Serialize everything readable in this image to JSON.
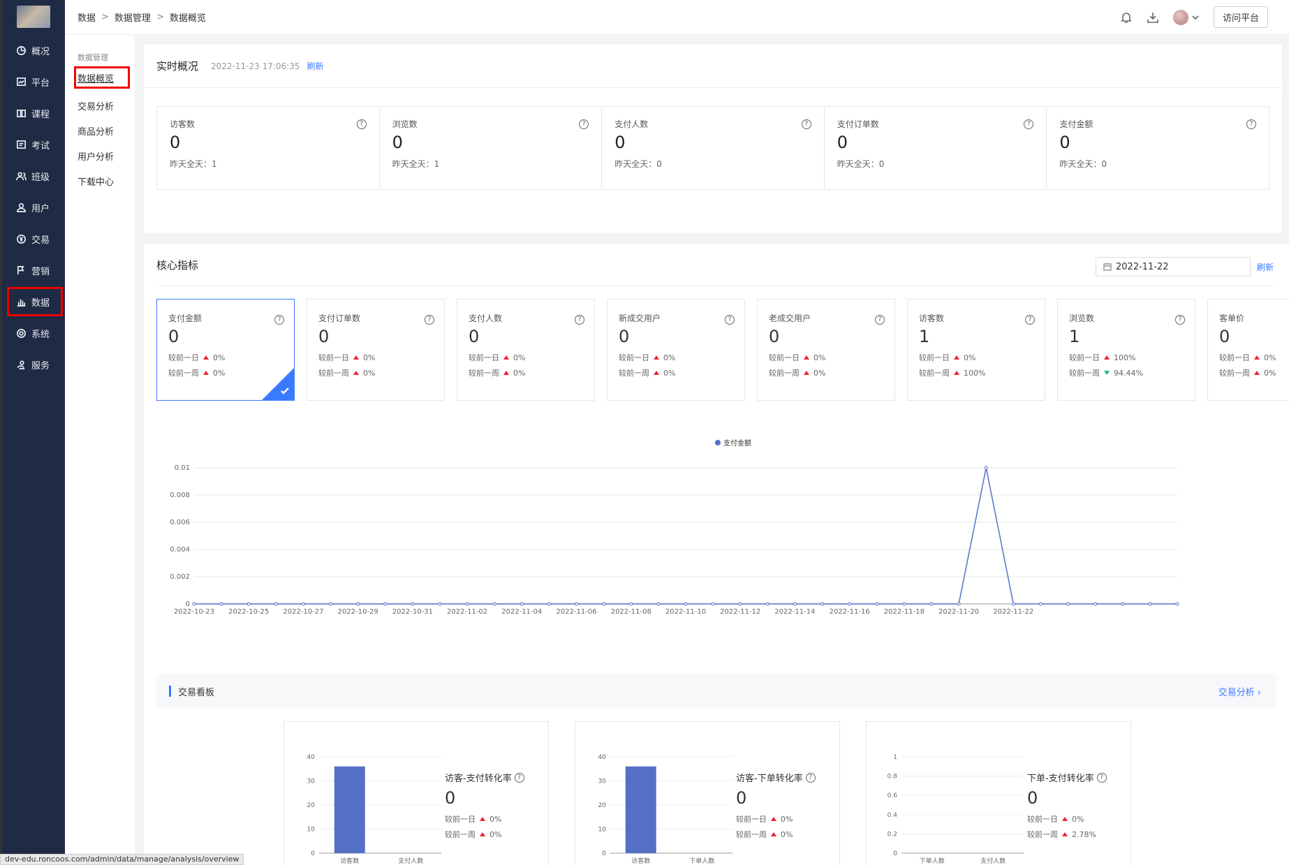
{
  "sidebar": {
    "items": [
      {
        "label": "概况",
        "icon": "pie-chart-icon"
      },
      {
        "label": "平台",
        "icon": "monitor-icon"
      },
      {
        "label": "课程",
        "icon": "book-icon"
      },
      {
        "label": "考试",
        "icon": "exam-icon"
      },
      {
        "label": "班级",
        "icon": "class-icon"
      },
      {
        "label": "用户",
        "icon": "user-icon"
      },
      {
        "label": "交易",
        "icon": "trade-icon"
      },
      {
        "label": "营销",
        "icon": "flag-icon"
      },
      {
        "label": "数据",
        "icon": "bar-chart-icon"
      },
      {
        "label": "系统",
        "icon": "gear-icon"
      },
      {
        "label": "服务",
        "icon": "service-icon"
      }
    ]
  },
  "subnav": {
    "group_title": "数据管理",
    "items": [
      "数据概览",
      "交易分析",
      "商品分析",
      "用户分析",
      "下载中心"
    ]
  },
  "breadcrumb": [
    "数据",
    "数据管理",
    "数据概览"
  ],
  "header": {
    "visit_button": "访问平台"
  },
  "realtime": {
    "title": "实时概况",
    "timestamp": "2022-11-23 17:06:35",
    "refresh": "刷新",
    "cells": [
      {
        "label": "访客数",
        "value": "0",
        "sub": "昨天全天：1"
      },
      {
        "label": "浏览数",
        "value": "0",
        "sub": "昨天全天：1"
      },
      {
        "label": "支付人数",
        "value": "0",
        "sub": "昨天全天：0"
      },
      {
        "label": "支付订单数",
        "value": "0",
        "sub": "昨天全天：0"
      },
      {
        "label": "支付金额",
        "value": "0",
        "sub": "昨天全天：0"
      }
    ]
  },
  "core": {
    "title": "核心指标",
    "date": "2022-11-22",
    "refresh": "刷新",
    "day_label": "较前一日",
    "week_label": "较前一周",
    "metrics": [
      {
        "label": "支付金额",
        "value": "0",
        "day": "0%",
        "week": "0%",
        "week_dir": "up"
      },
      {
        "label": "支付订单数",
        "value": "0",
        "day": "0%",
        "week": "0%",
        "week_dir": "up"
      },
      {
        "label": "支付人数",
        "value": "0",
        "day": "0%",
        "week": "0%",
        "week_dir": "up"
      },
      {
        "label": "新成交用户",
        "value": "0",
        "day": "0%",
        "week": "0%",
        "week_dir": "up"
      },
      {
        "label": "老成交用户",
        "value": "0",
        "day": "0%",
        "week": "0%",
        "week_dir": "up"
      },
      {
        "label": "访客数",
        "value": "1",
        "day": "0%",
        "week": "100%",
        "week_dir": "up"
      },
      {
        "label": "浏览数",
        "value": "1",
        "day": "100%",
        "week": "94.44%",
        "week_dir": "down"
      },
      {
        "label": "客单价",
        "value": "0",
        "day": "0%",
        "week": "0%",
        "week_dir": "up"
      }
    ]
  },
  "chart_data": [
    {
      "type": "line",
      "title": "",
      "series": [
        {
          "name": "支付金额",
          "color": "#5470c6",
          "values": [
            0,
            0,
            0,
            0,
            0,
            0,
            0,
            0,
            0,
            0,
            0,
            0,
            0,
            0,
            0,
            0,
            0,
            0,
            0,
            0,
            0,
            0,
            0,
            0,
            0,
            0,
            0,
            0,
            0,
            0.01,
            0,
            0,
            0,
            0,
            0,
            0,
            0
          ]
        }
      ],
      "x_tick_labels": [
        "2022-10-23",
        "2022-10-25",
        "2022-10-27",
        "2022-10-29",
        "2022-10-31",
        "2022-11-02",
        "2022-11-04",
        "2022-11-06",
        "2022-11-08",
        "2022-11-10",
        "2022-11-12",
        "2022-11-14",
        "2022-11-16",
        "2022-11-18",
        "2022-11-20",
        "2022-11-22"
      ],
      "ylim": [
        0,
        0.01
      ],
      "y_ticks": [
        "0",
        "0.002",
        "0.004",
        "0.006",
        "0.008",
        "0.01"
      ],
      "legend": "top-center",
      "grid": true
    },
    {
      "type": "bar",
      "categories": [
        "访客数",
        "支付人数"
      ],
      "values": [
        36,
        0
      ],
      "ylim": [
        0,
        40
      ],
      "y_ticks": [
        "0",
        "10",
        "20",
        "30",
        "40"
      ]
    },
    {
      "type": "bar",
      "categories": [
        "访客数",
        "下单人数"
      ],
      "values": [
        36,
        0
      ],
      "ylim": [
        0,
        40
      ],
      "y_ticks": [
        "0",
        "10",
        "20",
        "30",
        "40"
      ]
    },
    {
      "type": "bar",
      "categories": [
        "下单人数",
        "支付人数"
      ],
      "values": [
        0,
        0
      ],
      "ylim": [
        0,
        1
      ],
      "y_ticks": [
        "0",
        "0.2",
        "0.4",
        "0.6",
        "0.8",
        "1"
      ]
    }
  ],
  "trade_board": {
    "title": "交易看板",
    "link": "交易分析 ›",
    "cards": [
      {
        "title": "访客-支付转化率",
        "value": "0",
        "day": "0%",
        "week": "0%"
      },
      {
        "title": "访客-下单转化率",
        "value": "0",
        "day": "0%",
        "week": "0%"
      },
      {
        "title": "下单-支付转化率",
        "value": "0",
        "day": "0%",
        "week": "2.78%"
      }
    ]
  },
  "status_url": "dev-edu.roncoos.com/admin/data/manage/analysis/overview",
  "colors": {
    "accent": "#3a7afe",
    "sidebar": "#1f2a44",
    "up": "#e22233",
    "down": "#2bb673"
  }
}
